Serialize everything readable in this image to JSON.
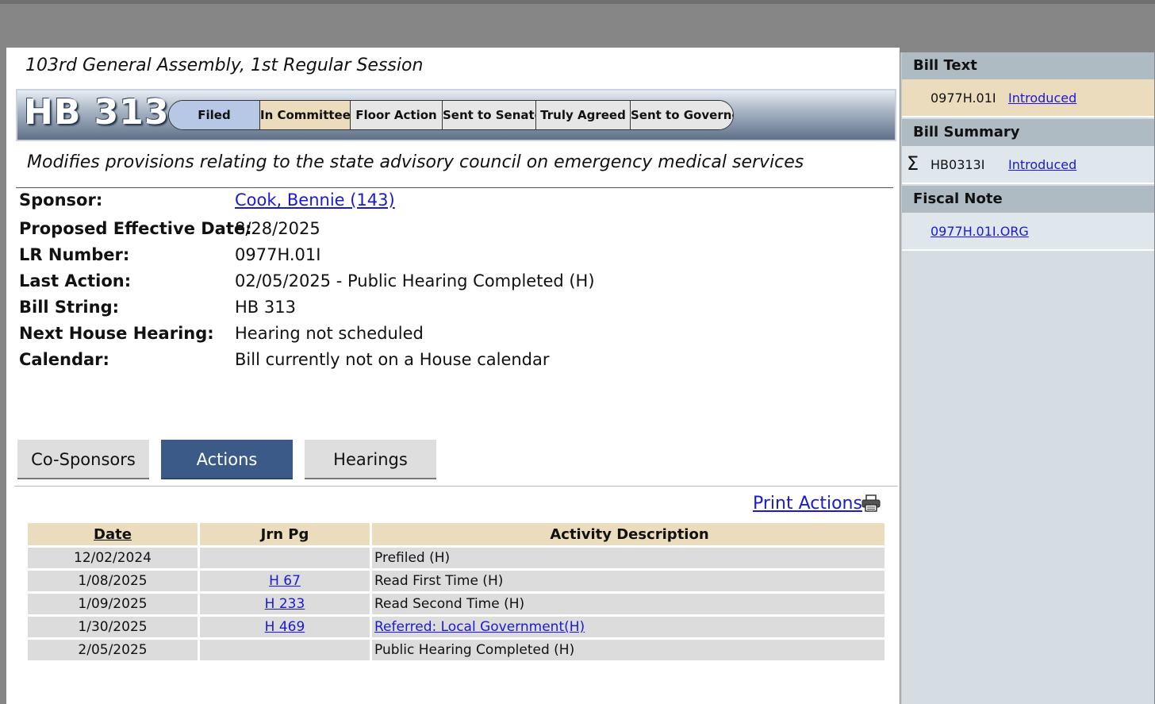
{
  "session": "103rd General Assembly, 1st Regular Session",
  "bill": {
    "number": "HB 313",
    "title": "Modifies provisions relating to the state advisory council on emergency medical services"
  },
  "status_steps": [
    {
      "label": "Filed",
      "state": "done"
    },
    {
      "label": "In Committee",
      "state": "current"
    },
    {
      "label": "Floor Action",
      "state": "pending"
    },
    {
      "label": "Sent to Senate",
      "state": "pending"
    },
    {
      "label": "Truly Agreed",
      "state": "pending"
    },
    {
      "label": "Sent to Governor",
      "state": "pending"
    }
  ],
  "info": {
    "sponsor_label": "Sponsor:",
    "sponsor_value": "Cook, Bennie (143)",
    "effective_label": "Proposed Effective Date:",
    "effective_value": "8/28/2025",
    "lr_label": "LR Number:",
    "lr_value": "0977H.01I",
    "last_action_label": "Last Action:",
    "last_action_value": "02/05/2025 - Public Hearing Completed (H)",
    "bill_string_label": "Bill String:",
    "bill_string_value": "HB 313",
    "next_hearing_label": "Next House Hearing:",
    "next_hearing_value": "Hearing not scheduled",
    "calendar_label": "Calendar:",
    "calendar_value": "Bill currently not on a House calendar"
  },
  "tabs": [
    {
      "label": "Co-Sponsors",
      "active": false
    },
    {
      "label": "Actions",
      "active": true
    },
    {
      "label": "Hearings",
      "active": false
    }
  ],
  "print_actions": "Print Actions",
  "actions_table": {
    "headers": {
      "date": "Date",
      "jrn": "Jrn Pg",
      "desc": "Activity Description"
    },
    "rows": [
      {
        "date": "12/02/2024",
        "jrn": "",
        "desc": "Prefiled (H)",
        "desc_link": false
      },
      {
        "date": "1/08/2025",
        "jrn": "H 67",
        "desc": "Read First Time (H)",
        "desc_link": false
      },
      {
        "date": "1/09/2025",
        "jrn": "H 233",
        "desc": "Read Second Time (H)",
        "desc_link": false
      },
      {
        "date": "1/30/2025",
        "jrn": "H 469",
        "desc": "Referred: Local Government(H)",
        "desc_link": true
      },
      {
        "date": "2/05/2025",
        "jrn": "",
        "desc": "Public Hearing Completed (H)",
        "desc_link": false
      }
    ]
  },
  "sidebar": {
    "bill_text_heading": "Bill Text",
    "bill_text_code": "0977H.01I",
    "bill_text_version": "Introduced",
    "summary_heading": "Bill Summary",
    "summary_symbol": "Σ",
    "summary_code": "HB0313I",
    "summary_version": "Introduced",
    "fiscal_heading": "Fiscal Note",
    "fiscal_link": "0977H.01I.ORG"
  },
  "colors": {
    "status_done": "#b6c8e6",
    "status_current": "#eadcbc",
    "tab_active": "#3b5a88",
    "table_header": "#eadcbc",
    "link": "#1a1ad6"
  }
}
